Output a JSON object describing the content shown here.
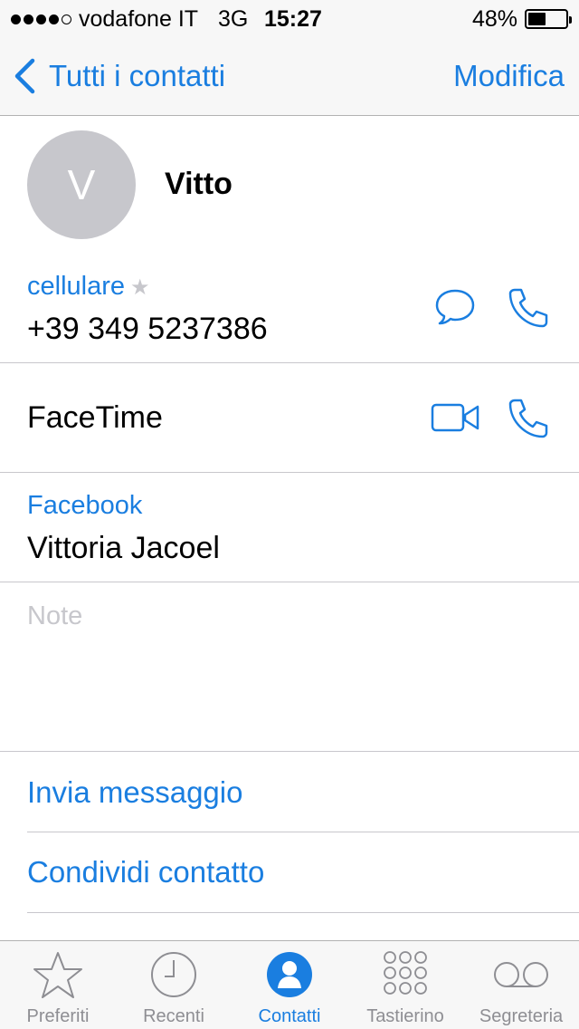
{
  "status_bar": {
    "carrier": "vodafone IT",
    "network": "3G",
    "time": "15:27",
    "battery": "48%",
    "battery_level": 0.48,
    "signal_bars_filled": 4,
    "signal_bars_total": 5
  },
  "nav": {
    "back_label": "Tutti i contatti",
    "edit_label": "Modifica"
  },
  "contact": {
    "initial": "V",
    "name": "Vitto"
  },
  "phone": {
    "label": "cellulare",
    "favorite_glyph": "★",
    "number": "+39 349 5237386"
  },
  "facetime": {
    "label": "FaceTime"
  },
  "facebook": {
    "label": "Facebook",
    "value": "Vittoria Jacoel"
  },
  "notes": {
    "placeholder": "Note"
  },
  "actions": {
    "send_message": "Invia messaggio",
    "share_contact": "Condividi contatto"
  },
  "tab_bar": {
    "active": "Contatti",
    "tabs": [
      {
        "label": "Preferiti",
        "icon": "star-icon"
      },
      {
        "label": "Recenti",
        "icon": "clock-icon"
      },
      {
        "label": "Contatti",
        "icon": "contacts-icon"
      },
      {
        "label": "Tastierino",
        "icon": "keypad-icon"
      },
      {
        "label": "Segreteria",
        "icon": "voicemail-icon"
      }
    ]
  },
  "colors": {
    "accent": "#1a7ee0",
    "inactive": "#8e8e93",
    "avatar_bg": "#c7c7cc",
    "bar_bg": "#f7f7f7"
  }
}
